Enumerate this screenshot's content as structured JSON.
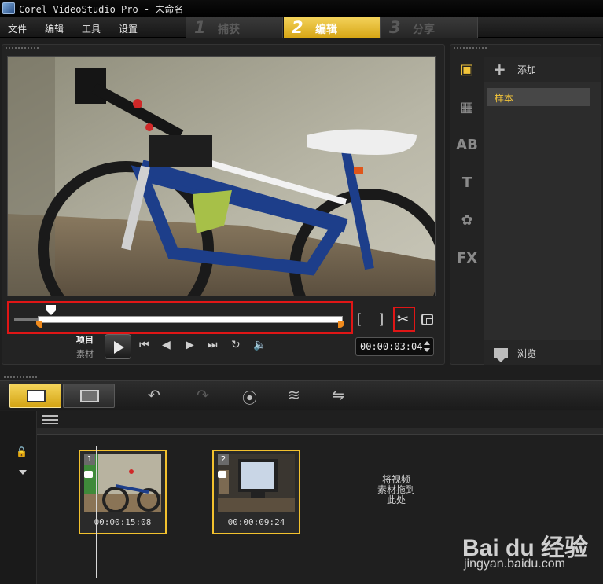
{
  "window": {
    "title": "Corel VideoStudio Pro - 未命名"
  },
  "menu": {
    "items": [
      "文件",
      "编辑",
      "工具",
      "设置"
    ]
  },
  "steps": [
    {
      "num": "1",
      "label": "捕获",
      "active": false
    },
    {
      "num": "2",
      "label": "编辑",
      "active": true
    },
    {
      "num": "3",
      "label": "分享",
      "active": false
    }
  ],
  "preview": {
    "mode_project": "项目",
    "mode_clip": "素材",
    "timecode": "00:00:03:04",
    "mark_in": "[",
    "mark_out": "]"
  },
  "library": {
    "add_label": "添加",
    "selected_item": "样本",
    "browse_label": "浏览",
    "side_text_icons": {
      "title": "AB",
      "text": "T",
      "fx": "FX"
    }
  },
  "timeline": {
    "clips": [
      {
        "index": "1",
        "duration": "00:00:15:08"
      },
      {
        "index": "2",
        "duration": "00:00:09:24"
      }
    ],
    "drop_hint_lines": [
      "将视频",
      "素材拖到",
      "此处"
    ]
  },
  "watermark": {
    "logo": "Bai du 经验",
    "url": "jingyan.baidu.com"
  },
  "colors": {
    "accent": "#f3c53a",
    "highlight_box": "#e01616",
    "tab_active": "#d7a615"
  }
}
